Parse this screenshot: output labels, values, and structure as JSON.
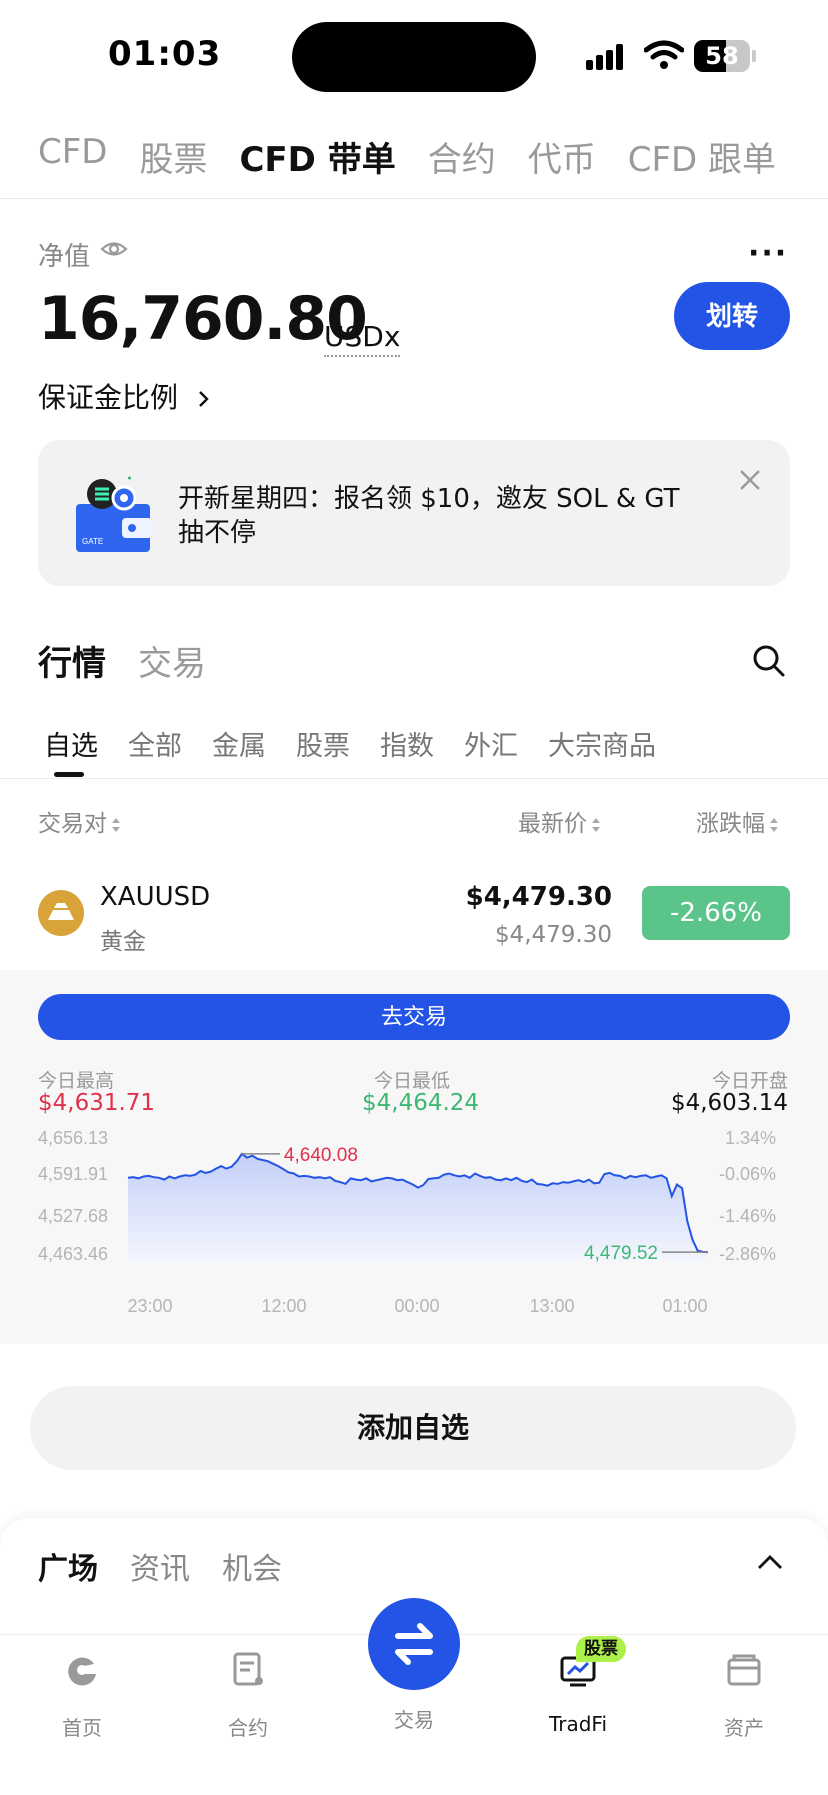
{
  "status": {
    "time": "01:03",
    "battery": "58"
  },
  "top_tabs": [
    {
      "label": "CFD",
      "active": false
    },
    {
      "label": "股票",
      "active": false
    },
    {
      "label": "CFD 带单",
      "active": true
    },
    {
      "label": "合约",
      "active": false
    },
    {
      "label": "代币",
      "active": false
    },
    {
      "label": "CFD 跟单",
      "active": false
    }
  ],
  "account": {
    "nav_label": "净值",
    "nav_value": "16,760.80",
    "unit": "USDx",
    "transfer_label": "划转",
    "margin_label": "保证金比例",
    "more": "···"
  },
  "promo": {
    "text": "开新星期四：报名领 $10，邀友 SOL & GT 抽不停",
    "brand": "GATE"
  },
  "market_tabs": [
    {
      "label": "行情",
      "active": true
    },
    {
      "label": "交易",
      "active": false
    }
  ],
  "sub_tabs": [
    {
      "label": "自选",
      "active": true
    },
    {
      "label": "全部"
    },
    {
      "label": "金属"
    },
    {
      "label": "股票"
    },
    {
      "label": "指数"
    },
    {
      "label": "外汇"
    },
    {
      "label": "大宗商品"
    }
  ],
  "columns": {
    "pair": "交易对",
    "last": "最新价",
    "change": "涨跌幅"
  },
  "row": {
    "symbol": "XAUUSD",
    "name": "黄金",
    "price": "$4,479.30",
    "price_sub": "$4,479.30",
    "change": "-2.66%"
  },
  "detail": {
    "trade_label": "去交易",
    "high_label": "今日最高",
    "high_value": "$4,631.71",
    "low_label": "今日最低",
    "low_value": "$4,464.24",
    "open_label": "今日开盘",
    "open_value": "$4,603.14"
  },
  "colors": {
    "accent": "#2354e6",
    "up": "#e0314b",
    "down": "#3db874",
    "badge_down": "#5ac48a"
  },
  "chart_data": {
    "type": "area",
    "y_ticks_left": [
      "4,656.13",
      "4,591.91",
      "4,527.68",
      "4,463.46"
    ],
    "y_ticks_right": [
      "1.34%",
      "-0.06%",
      "-1.46%",
      "-2.86%"
    ],
    "x_ticks": [
      "23:00",
      "12:00",
      "00:00",
      "13:00",
      "01:00"
    ],
    "ylim": [
      4463.46,
      4656.13
    ],
    "annotations": {
      "max": "4,640.08",
      "last": "4,479.52"
    },
    "values": [
      4601,
      4602,
      4600,
      4603,
      4604,
      4602,
      4601,
      4598,
      4603,
      4600,
      4603,
      4605,
      4604,
      4606,
      4612,
      4609,
      4611,
      4616,
      4620,
      4616,
      4619,
      4628,
      4640,
      4634,
      4637,
      4632,
      4630,
      4628,
      4624,
      4620,
      4615,
      4610,
      4608,
      4603,
      4604,
      4603,
      4601,
      4602,
      4600,
      4602,
      4596,
      4594,
      4591,
      4600,
      4598,
      4597,
      4600,
      4595,
      4597,
      4599,
      4601,
      4600,
      4597,
      4598,
      4594,
      4590,
      4585,
      4589,
      4599,
      4600,
      4601,
      4606,
      4608,
      4605,
      4603,
      4605,
      4601,
      4608,
      4604,
      4601,
      4602,
      4598,
      4597,
      4600,
      4597,
      4601,
      4596,
      4594,
      4598,
      4591,
      4590,
      4588,
      4592,
      4591,
      4594,
      4593,
      4595,
      4597,
      4594,
      4598,
      4592,
      4593,
      4607,
      4609,
      4605,
      4604,
      4600,
      4604,
      4602,
      4604,
      4605,
      4601,
      4603,
      4605,
      4600,
      4571,
      4590,
      4584,
      4530,
      4500,
      4482,
      4480,
      4479.52
    ]
  },
  "add_watch_label": "添加自选",
  "plaza_tabs": [
    {
      "label": "广场",
      "active": true
    },
    {
      "label": "资讯",
      "active": false
    },
    {
      "label": "机会",
      "active": false
    }
  ],
  "bottom_nav": {
    "home": "首页",
    "futures": "合约",
    "trade": "交易",
    "tradfi": "TradFi",
    "tradfi_badge": "股票",
    "assets": "资产"
  }
}
